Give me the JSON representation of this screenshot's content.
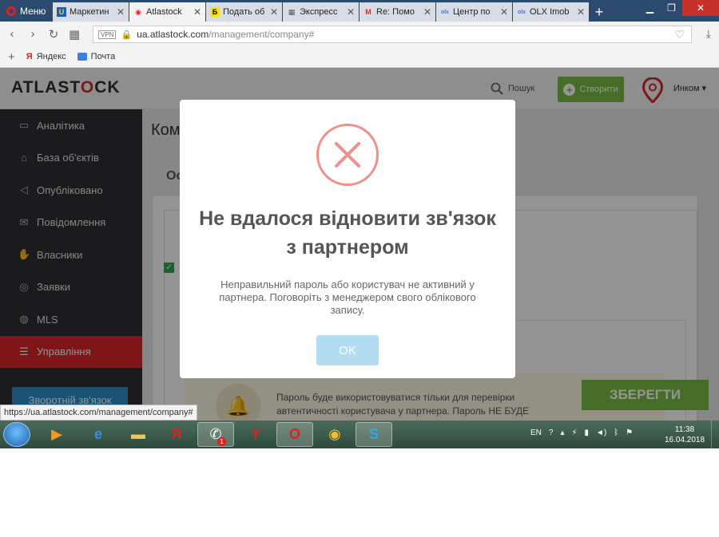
{
  "browser": {
    "menu_label": "Меню",
    "tabs": [
      {
        "label": "Маркетин",
        "icon": "ukrnet-icon"
      },
      {
        "label": "Atlastock",
        "icon": "atlastock-pin-icon",
        "active": true
      },
      {
        "label": "Подать об",
        "icon": "b-icon"
      },
      {
        "label": "Экспресс",
        "icon": "grid-icon"
      },
      {
        "label": "Re: Помо",
        "icon": "gmail-icon"
      },
      {
        "label": "Центр по",
        "icon": "olx-icon"
      },
      {
        "label": "OLX Imob",
        "icon": "olx-icon"
      }
    ],
    "url_host": "ua.atlastock.com",
    "url_path": "/management/company#",
    "vpn_label": "VPN",
    "bookmarks": [
      {
        "label": "Яндекс",
        "icon": "yandex-icon"
      },
      {
        "label": "Почта",
        "icon": "mail-icon"
      }
    ],
    "status_url": "https://ua.atlastock.com/management/company#"
  },
  "app": {
    "logo": {
      "before": "ATLAST",
      "pin": "O",
      "after": "CK"
    },
    "search_label": "Пошук",
    "create_label": "Створити",
    "user_name": "Инком ▾",
    "sidebar": [
      {
        "label": "Аналітика",
        "icon": "monitor-icon",
        "glyph": "▭"
      },
      {
        "label": "База об'єктів",
        "icon": "home-icon",
        "glyph": "⌂"
      },
      {
        "label": "Опубліковано",
        "icon": "megaphone-icon",
        "glyph": "◁"
      },
      {
        "label": "Повідомлення",
        "icon": "envelope-icon",
        "glyph": "✉"
      },
      {
        "label": "Власники",
        "icon": "thumbs-up-icon",
        "glyph": "✋"
      },
      {
        "label": "Заявки",
        "icon": "target-icon",
        "glyph": "◎"
      },
      {
        "label": "MLS",
        "icon": "globe-icon",
        "glyph": "◍"
      },
      {
        "label": "Управління",
        "icon": "database-icon",
        "glyph": "☰",
        "active": true
      }
    ],
    "feedback_label": "Зворотній зв'язок",
    "page_title": "Ком",
    "section_tab": "Ос",
    "hint_text": "Пароль буде використовуватися тільки для перевірки автентичності користувача у партнера. Пароль НЕ БУДЕ",
    "save_label": "ЗБЕРЕГТИ"
  },
  "modal": {
    "title": "Не вдалося відновити зв'язок з партнером",
    "message": "Неправильний пароль або користувач не активний у партнера. Поговоріть з менеджером свого облікового запису.",
    "ok_label": "OK",
    "icon": "error-x-icon"
  },
  "taskbar": {
    "lang": "EN",
    "time": "11:38",
    "date": "16.04.2018",
    "apps": [
      "media-player-icon",
      "ie-icon",
      "explorer-icon",
      "yandex-icon",
      "viber-icon",
      "yandex-browser-icon",
      "opera-icon",
      "chrome-icon",
      "skype-icon"
    ],
    "viber_badge": "1"
  },
  "colors": {
    "accent_red": "#d9262a",
    "green": "#78bc44",
    "sidebar_bg": "#2f3033",
    "ok_button": "#b3dcf1"
  }
}
